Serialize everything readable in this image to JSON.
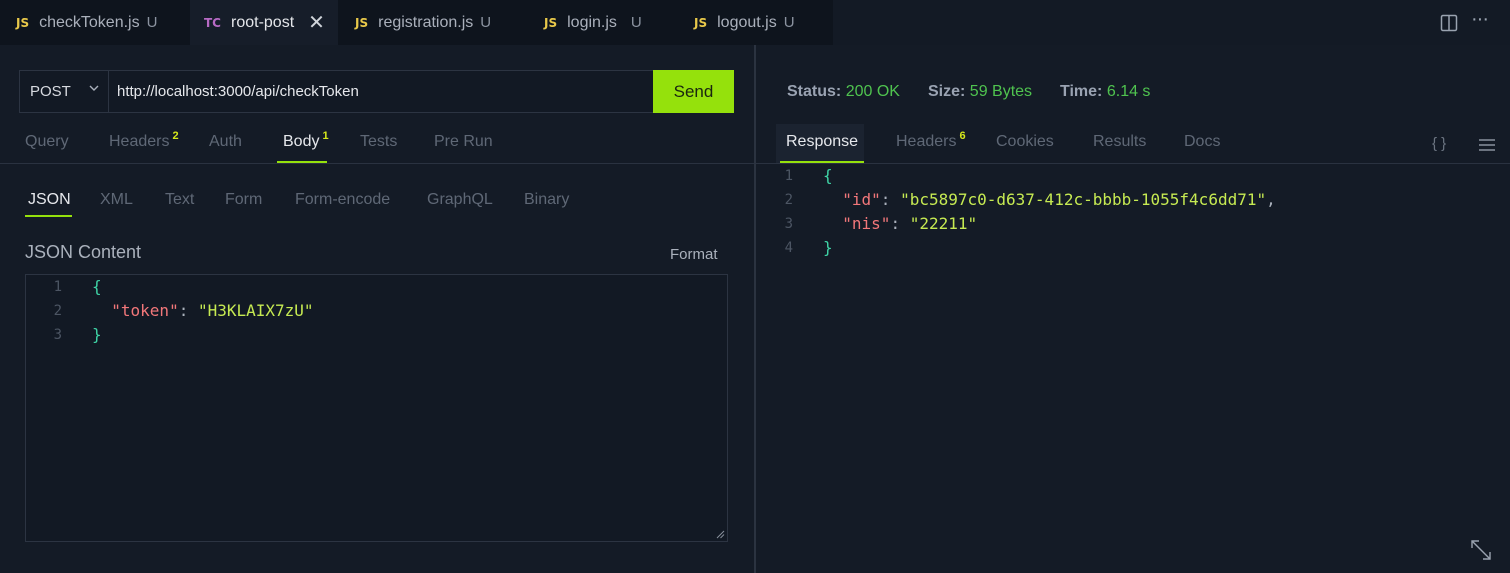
{
  "tabs": [
    {
      "type": "JS",
      "name": "checkToken.js",
      "mark": "U"
    },
    {
      "type": "TC",
      "name": "root-post",
      "close": "✕"
    },
    {
      "type": "JS",
      "name": "registration.js",
      "mark": "U"
    },
    {
      "type": "JS",
      "name": "login.js",
      "mark": "U"
    },
    {
      "type": "JS",
      "name": "logout.js",
      "mark": "U"
    }
  ],
  "top_icons": {
    "split": "split-editor-icon",
    "more": "···"
  },
  "request": {
    "method": "POST",
    "url": "http://localhost:3000/api/checkToken",
    "send_label": "Send"
  },
  "request_tabs": [
    {
      "label": "Query"
    },
    {
      "label": "Headers",
      "badge": "2"
    },
    {
      "label": "Auth"
    },
    {
      "label": "Body",
      "badge": "1"
    },
    {
      "label": "Tests"
    },
    {
      "label": "Pre Run"
    }
  ],
  "body_tabs": [
    "JSON",
    "XML",
    "Text",
    "Form",
    "Form-encode",
    "GraphQL",
    "Binary"
  ],
  "json_content_label": "JSON Content",
  "format_label": "Format",
  "request_body": {
    "line_numbers": [
      "1",
      "2",
      "3"
    ],
    "open": "{",
    "key": "\"token\"",
    "colon": ": ",
    "value": "\"H3KLAIX7zU\"",
    "close": "}"
  },
  "status": {
    "status_label": "Status:",
    "status_value": "200 OK",
    "size_label": "Size:",
    "size_value": "59 Bytes",
    "time_label": "Time:",
    "time_value": "6.14 s"
  },
  "response_tabs": [
    {
      "label": "Response"
    },
    {
      "label": "Headers",
      "badge": "6"
    },
    {
      "label": "Cookies"
    },
    {
      "label": "Results"
    },
    {
      "label": "Docs"
    }
  ],
  "response_icons": {
    "braces": "{ }",
    "menu": "menu-icon"
  },
  "response_body": {
    "line_numbers": [
      "1",
      "2",
      "3",
      "4"
    ],
    "open": "{",
    "k1": "\"id\"",
    "v1": "\"bc5897c0-d637-412c-bbbb-1055f4c6dd71\"",
    "k2": "\"nis\"",
    "v2": "\"22211\"",
    "colon": ": ",
    "comma": ",",
    "close": "}"
  },
  "colors": {
    "accent": "#95e10c",
    "ok": "#4fc34f",
    "background": "#141b26"
  }
}
